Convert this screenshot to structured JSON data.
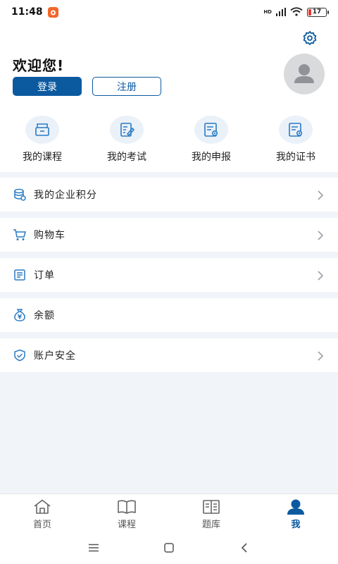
{
  "status_bar": {
    "time": "11:48",
    "network": "HD",
    "battery": "17"
  },
  "header": {
    "welcome": "欢迎您!",
    "login_label": "登录",
    "register_label": "注册",
    "settings_icon": "gear-icon",
    "avatar_icon": "user-avatar-icon"
  },
  "quick_links": [
    {
      "label": "我的课程",
      "icon": "course-icon"
    },
    {
      "label": "我的考试",
      "icon": "exam-icon"
    },
    {
      "label": "我的申报",
      "icon": "declaration-icon"
    },
    {
      "label": "我的证书",
      "icon": "certificate-icon"
    }
  ],
  "menu": [
    {
      "label": "我的企业积分",
      "icon": "points-icon",
      "chevron": true
    },
    {
      "label": "购物车",
      "icon": "cart-icon",
      "chevron": true
    },
    {
      "label": "订单",
      "icon": "order-icon",
      "chevron": true
    },
    {
      "label": "余额",
      "icon": "balance-icon",
      "chevron": false
    },
    {
      "label": "账户安全",
      "icon": "shield-icon",
      "chevron": true
    }
  ],
  "tabs": [
    {
      "label": "首页",
      "icon": "home-icon",
      "active": false
    },
    {
      "label": "课程",
      "icon": "book-icon",
      "active": false
    },
    {
      "label": "题库",
      "icon": "question-bank-icon",
      "active": false
    },
    {
      "label": "我",
      "icon": "person-icon",
      "active": true
    }
  ],
  "colors": {
    "accent": "#0b5aa0",
    "background": "#f1f4f8",
    "icon_blue": "#2a7bc4"
  }
}
